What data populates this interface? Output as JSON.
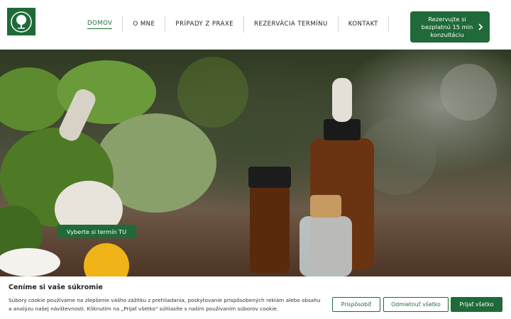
{
  "header": {
    "logo_icon": "tree-logo-icon",
    "nav": [
      {
        "label": "DOMOV",
        "active": true
      },
      {
        "label": "O MNE"
      },
      {
        "label": "PRÍPADY Z PRAXE"
      },
      {
        "label": "REZERVÁCIA TERMÍNU"
      },
      {
        "label": "KONTAKT"
      }
    ],
    "cta_label": "Rezervujte si bezplatnú 15 min konzultáciu",
    "cta_icon": "chevron-right-icon"
  },
  "hero": {
    "button_label": "Vyberte si termín TU"
  },
  "cookie": {
    "title": "Ceníme si vaše súkromie",
    "text": "Súbory cookie používame na zlepšenie vášho zážitku z prehliadania, poskytovanie prispôsobených reklám alebo obsahu a analýzu našej návštevnosti. Kliknutím na „Prijať všetko\" súhlasíte s naším používaním súborov cookie.",
    "customize_label": "Prispôsobiť",
    "reject_label": "Odmietnuť všetko",
    "accept_label": "Prijať všetko"
  },
  "colors": {
    "brand_green": "#1f6a38"
  }
}
